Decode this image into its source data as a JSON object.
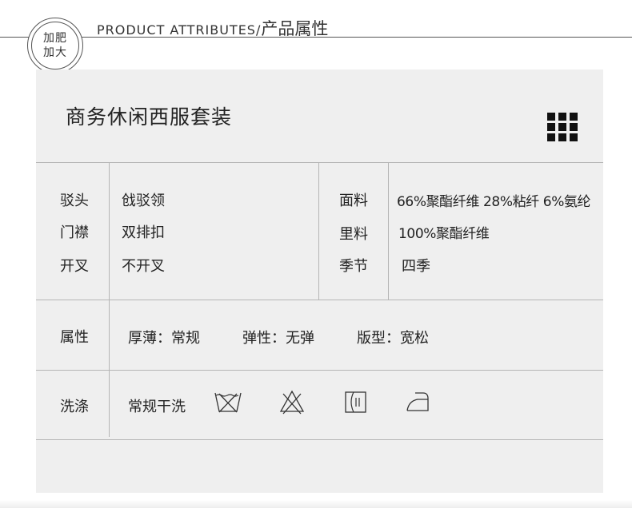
{
  "header": {
    "badge_line1": "加肥",
    "badge_line2": "加大",
    "title_en": "PRODUCT ATTRIBUTES/",
    "title_zh": "产品属性"
  },
  "product": {
    "name": "商务休闲西服套装",
    "icon": "grid-icon"
  },
  "specs_left": [
    {
      "label": "驳头",
      "value": "戗驳领"
    },
    {
      "label": "门襟",
      "value": "双排扣"
    },
    {
      "label": "开叉",
      "value": "不开叉"
    }
  ],
  "specs_right": [
    {
      "label": "面料",
      "value": "66%聚酯纤维 28%粘纤 6%氨纶"
    },
    {
      "label": "里料",
      "value": "100%聚酯纤维"
    },
    {
      "label": "季节",
      "value": "四季"
    }
  ],
  "attributes": {
    "label": "属性",
    "thickness": "厚薄：常规",
    "elasticity": "弹性：无弹",
    "fit": "版型：宽松"
  },
  "washing": {
    "label": "洗涤",
    "method": "常规干洗",
    "icons": [
      "do-not-wash-icon",
      "do-not-bleach-icon",
      "tumble-dry-icon",
      "iron-icon"
    ]
  }
}
